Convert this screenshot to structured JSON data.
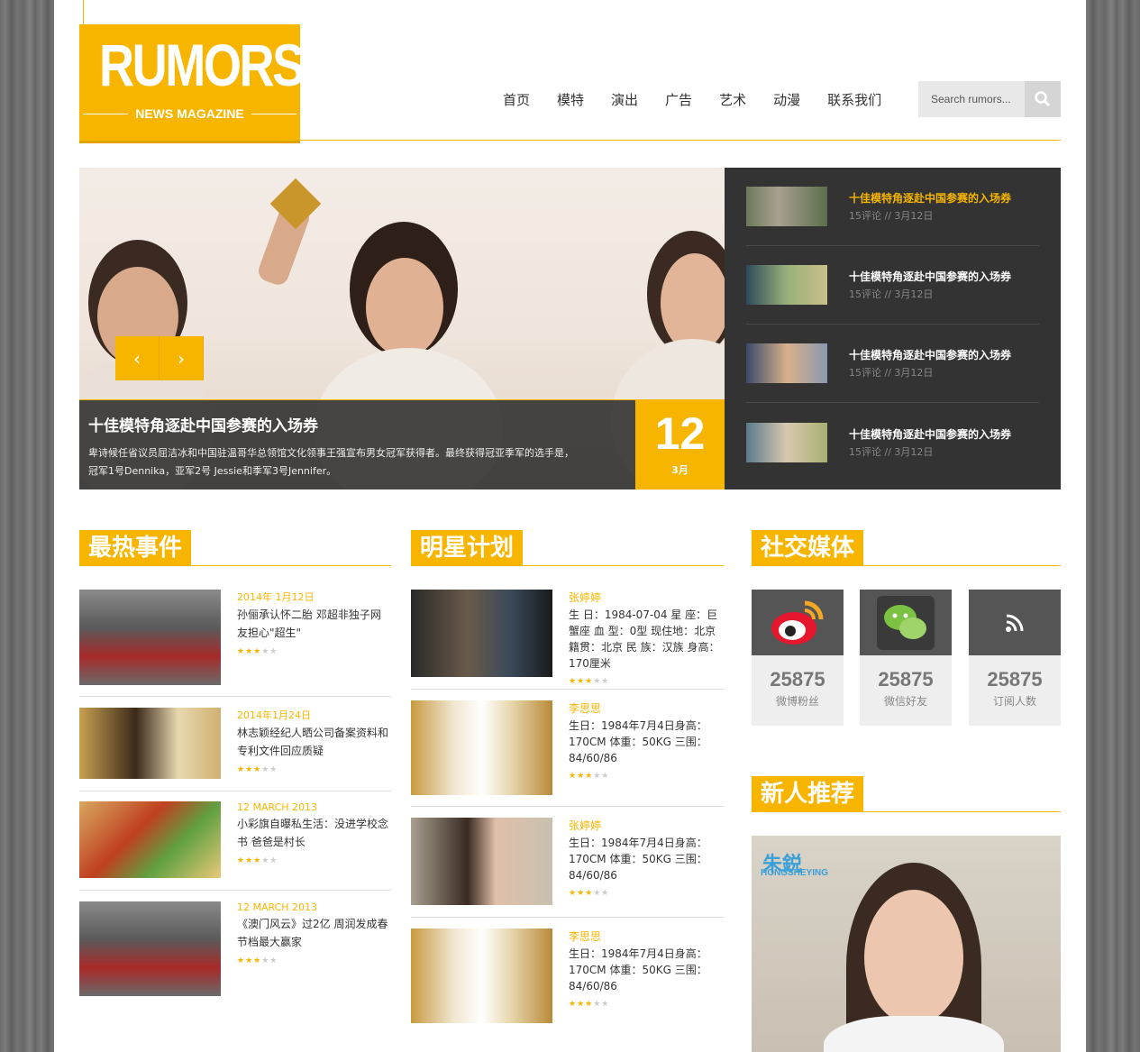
{
  "header": {
    "logo_title": "RUMORS",
    "logo_subtitle": "NEWS MAGAZINE",
    "nav": [
      "首页",
      "模特",
      "演出",
      "广告",
      "艺术",
      "动漫",
      "联系我们"
    ],
    "search_placeholder": "Search rumors..."
  },
  "colors": {
    "accent": "#f7b500",
    "dark_panel": "#333333"
  },
  "hero": {
    "title": "十佳模特角逐赴中国参赛的入场券",
    "desc_line1": "卑诗候任省议员屈洁冰和中国驻温哥华总领馆文化领事王强宣布男女冠军获得者。最终获得冠亚季军的选手是，",
    "desc_line2": "冠军1号Dennika，亚军2号 Jessie和季军3号Jennifer。",
    "day": "12",
    "month": "3月",
    "prev_icon": "‹",
    "next_icon": "›"
  },
  "side_news": [
    {
      "title": "十佳模特角逐赴中国参赛的入场券",
      "meta": "15评论 // 3月12日"
    },
    {
      "title": "十佳模特角逐赴中国参赛的入场券",
      "meta": "15评论 // 3月12日"
    },
    {
      "title": "十佳模特角逐赴中国参赛的入场券",
      "meta": "15评论 // 3月12日"
    },
    {
      "title": "十佳模特角逐赴中国参赛的入场券",
      "meta": "15评论 // 3月12日"
    }
  ],
  "sections": {
    "hot": "最热事件",
    "stars": "明星计划",
    "social": "社交媒体",
    "newbie": "新人推荐"
  },
  "hot_items": [
    {
      "date": "2014年 1月12日",
      "title": "孙俪承认怀二胎 邓超非独子网友担心\"超生\"",
      "rating": 3
    },
    {
      "date": "2014年1月24日",
      "title": "林志颖经纪人晒公司备案资料和专利文件回应质疑",
      "rating": 3
    },
    {
      "date": "12 MARCH 2013",
      "title": "小彩旗自曝私生活：没进学校念书 爸爸是村长",
      "rating": 3
    },
    {
      "date": "12 MARCH 2013",
      "title": "《澳门风云》过2亿 周润发成春节档最大赢家",
      "rating": 3
    }
  ],
  "star_items": [
    {
      "name": "张婷婷",
      "bio": "生 日：1984-07-04 星 座：巨蟹座 血 型：0型 现住地：北京 籍贯：北京 民 族：汉族 身高：170厘米",
      "rating": 3
    },
    {
      "name": "李思思",
      "bio": "生日：1984年7月4日身高：170CM 体重：50KG 三围：84/60/86",
      "rating": 3
    },
    {
      "name": "张婷婷",
      "bio": "生日：1984年7月4日身高：170CM 体重：50KG 三围：84/60/86",
      "rating": 3
    },
    {
      "name": "李思思",
      "bio": "生日：1984年7月4日身高：170CM 体重：50KG 三围：84/60/86",
      "rating": 3
    }
  ],
  "social": [
    {
      "icon": "weibo-icon",
      "count": "25875",
      "label": "微博粉丝"
    },
    {
      "icon": "wechat-icon",
      "count": "25875",
      "label": "微信好友"
    },
    {
      "icon": "rss-icon",
      "count": "25875",
      "label": "订阅人数"
    }
  ],
  "newbie": {
    "tag": "朱鋭",
    "tag_sub": "HONGSHEYING"
  }
}
